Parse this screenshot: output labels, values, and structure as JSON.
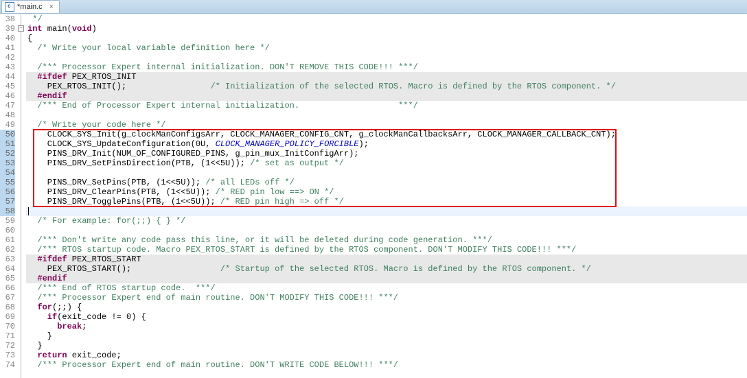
{
  "tab": {
    "title": "*main.c",
    "close_glyph": "✕"
  },
  "lines": [
    {
      "n": "38",
      "cls": "",
      "tokens": [
        {
          "t": " */",
          "c": "cm"
        }
      ]
    },
    {
      "n": "39",
      "cls": "",
      "fold": "-",
      "tokens": [
        {
          "t": "int",
          "c": "kw"
        },
        {
          "t": " main(",
          "c": ""
        },
        {
          "t": "void",
          "c": "kw"
        },
        {
          "t": ")",
          "c": ""
        }
      ]
    },
    {
      "n": "40",
      "cls": "",
      "tokens": [
        {
          "t": "{",
          "c": ""
        }
      ]
    },
    {
      "n": "41",
      "cls": "",
      "tokens": [
        {
          "t": "  /* Write your local variable definition here */",
          "c": "cm"
        }
      ]
    },
    {
      "n": "42",
      "cls": "",
      "tokens": []
    },
    {
      "n": "43",
      "cls": "",
      "tokens": [
        {
          "t": "  /*** Processor Expert internal initialization. DON'T REMOVE THIS CODE!!! ***/",
          "c": "cm"
        }
      ]
    },
    {
      "n": "44",
      "cls": "shade",
      "tokens": [
        {
          "t": "  #ifdef",
          "c": "kw"
        },
        {
          "t": " PEX_RTOS_INIT",
          "c": ""
        }
      ]
    },
    {
      "n": "45",
      "cls": "shade",
      "tokens": [
        {
          "t": "    PEX_RTOS_INIT();",
          "c": ""
        },
        {
          "t": "                 /* Initialization of the selected RTOS. Macro is defined by the RTOS component. */",
          "c": "cm"
        }
      ]
    },
    {
      "n": "46",
      "cls": "shade",
      "tokens": [
        {
          "t": "  #endif",
          "c": "kw"
        }
      ]
    },
    {
      "n": "47",
      "cls": "",
      "tokens": [
        {
          "t": "  /*** End of Processor Expert internal initialization.                    ***/",
          "c": "cm"
        }
      ]
    },
    {
      "n": "48",
      "cls": "",
      "tokens": []
    },
    {
      "n": "49",
      "cls": "",
      "tokens": [
        {
          "t": "  /* Write your code here */",
          "c": "cm"
        }
      ]
    },
    {
      "n": "50",
      "cls": "",
      "gmod": true,
      "tokens": [
        {
          "t": "    CLOCK_SYS_Init(g_clockManConfigsArr, CLOCK_MANAGER_CONFIG_CNT, g_clockManCallbacksArr, CLOCK_MANAGER_CALLBACK_CNT);",
          "c": ""
        }
      ]
    },
    {
      "n": "51",
      "cls": "",
      "gmod": true,
      "tokens": [
        {
          "t": "    CLOCK_SYS_UpdateConfiguration(0U, ",
          "c": ""
        },
        {
          "t": "CLOCK_MANAGER_POLICY_FORCIBLE",
          "c": "mc"
        },
        {
          "t": ");",
          "c": ""
        }
      ]
    },
    {
      "n": "52",
      "cls": "",
      "gmod": true,
      "tokens": [
        {
          "t": "    PINS_DRV_Init(NUM_OF_CONFIGURED_PINS, g_pin_mux_InitConfigArr);",
          "c": ""
        }
      ]
    },
    {
      "n": "53",
      "cls": "",
      "gmod": true,
      "tokens": [
        {
          "t": "    PINS_DRV_SetPinsDirection(PTB, (1<<5U)); ",
          "c": ""
        },
        {
          "t": "/* set as output */",
          "c": "cm"
        }
      ]
    },
    {
      "n": "54",
      "cls": "",
      "gmod": true,
      "tokens": []
    },
    {
      "n": "55",
      "cls": "",
      "gmod": true,
      "tokens": [
        {
          "t": "    PINS_DRV_SetPins(PTB, (1<<5U)); ",
          "c": ""
        },
        {
          "t": "/* all LEDs off */",
          "c": "cm"
        }
      ]
    },
    {
      "n": "56",
      "cls": "",
      "gmod": true,
      "tokens": [
        {
          "t": "    PINS_DRV_ClearPins(PTB, (1<<5U)); ",
          "c": ""
        },
        {
          "t": "/* RED pin low ==> ON */",
          "c": "cm"
        }
      ]
    },
    {
      "n": "57",
      "cls": "",
      "gmod": true,
      "tokens": [
        {
          "t": "    PINS_DRV_TogglePins(PTB, (1<<5U)); ",
          "c": ""
        },
        {
          "t": "/* RED pin high => off */",
          "c": "cm"
        }
      ]
    },
    {
      "n": "58",
      "cls": "cur-line",
      "gmod": true,
      "caret": true,
      "tokens": []
    },
    {
      "n": "59",
      "cls": "",
      "tokens": [
        {
          "t": "  /* For example: for(;;) { } */",
          "c": "cm"
        }
      ]
    },
    {
      "n": "60",
      "cls": "",
      "tokens": []
    },
    {
      "n": "61",
      "cls": "",
      "tokens": [
        {
          "t": "  /*** Don't write any code pass this line, or it will be deleted during code generation. ***/",
          "c": "cm"
        }
      ]
    },
    {
      "n": "62",
      "cls": "",
      "tokens": [
        {
          "t": "  /*** RTOS startup code. Macro PEX_RTOS_START is defined by the RTOS component. DON'T MODIFY THIS CODE!!! ***/",
          "c": "cm"
        }
      ]
    },
    {
      "n": "63",
      "cls": "shade",
      "tokens": [
        {
          "t": "  #ifdef",
          "c": "kw"
        },
        {
          "t": " PEX_RTOS_START",
          "c": ""
        }
      ]
    },
    {
      "n": "64",
      "cls": "shade",
      "tokens": [
        {
          "t": "    PEX_RTOS_START();",
          "c": ""
        },
        {
          "t": "                  /* Startup of the selected RTOS. Macro is defined by the RTOS component. */",
          "c": "cm"
        }
      ]
    },
    {
      "n": "65",
      "cls": "shade",
      "tokens": [
        {
          "t": "  #endif",
          "c": "kw"
        }
      ]
    },
    {
      "n": "66",
      "cls": "",
      "tokens": [
        {
          "t": "  /*** End of RTOS startup code.  ***/",
          "c": "cm"
        }
      ]
    },
    {
      "n": "67",
      "cls": "",
      "tokens": [
        {
          "t": "  /*** Processor Expert end of main routine. DON'T MODIFY THIS CODE!!! ***/",
          "c": "cm"
        }
      ]
    },
    {
      "n": "68",
      "cls": "",
      "tokens": [
        {
          "t": "  for",
          "c": "kw"
        },
        {
          "t": "(;;) {",
          "c": ""
        }
      ]
    },
    {
      "n": "69",
      "cls": "",
      "tokens": [
        {
          "t": "    if",
          "c": "kw"
        },
        {
          "t": "(exit_code != 0) {",
          "c": ""
        }
      ]
    },
    {
      "n": "70",
      "cls": "",
      "tokens": [
        {
          "t": "      break",
          "c": "kw"
        },
        {
          "t": ";",
          "c": ""
        }
      ]
    },
    {
      "n": "71",
      "cls": "",
      "tokens": [
        {
          "t": "    }",
          "c": ""
        }
      ]
    },
    {
      "n": "72",
      "cls": "",
      "tokens": [
        {
          "t": "  }",
          "c": ""
        }
      ]
    },
    {
      "n": "73",
      "cls": "",
      "tokens": [
        {
          "t": "  return",
          "c": "kw"
        },
        {
          "t": " exit_code;",
          "c": ""
        }
      ]
    },
    {
      "n": "74",
      "cls": "",
      "tokens": [
        {
          "t": "  /*** Processor Expert end of main routine. DON'T WRITE CODE BELOW!!! ***/",
          "c": "cm"
        }
      ]
    }
  ],
  "redbox": {
    "top_line_index": 12,
    "bottom_line_index": 19
  }
}
